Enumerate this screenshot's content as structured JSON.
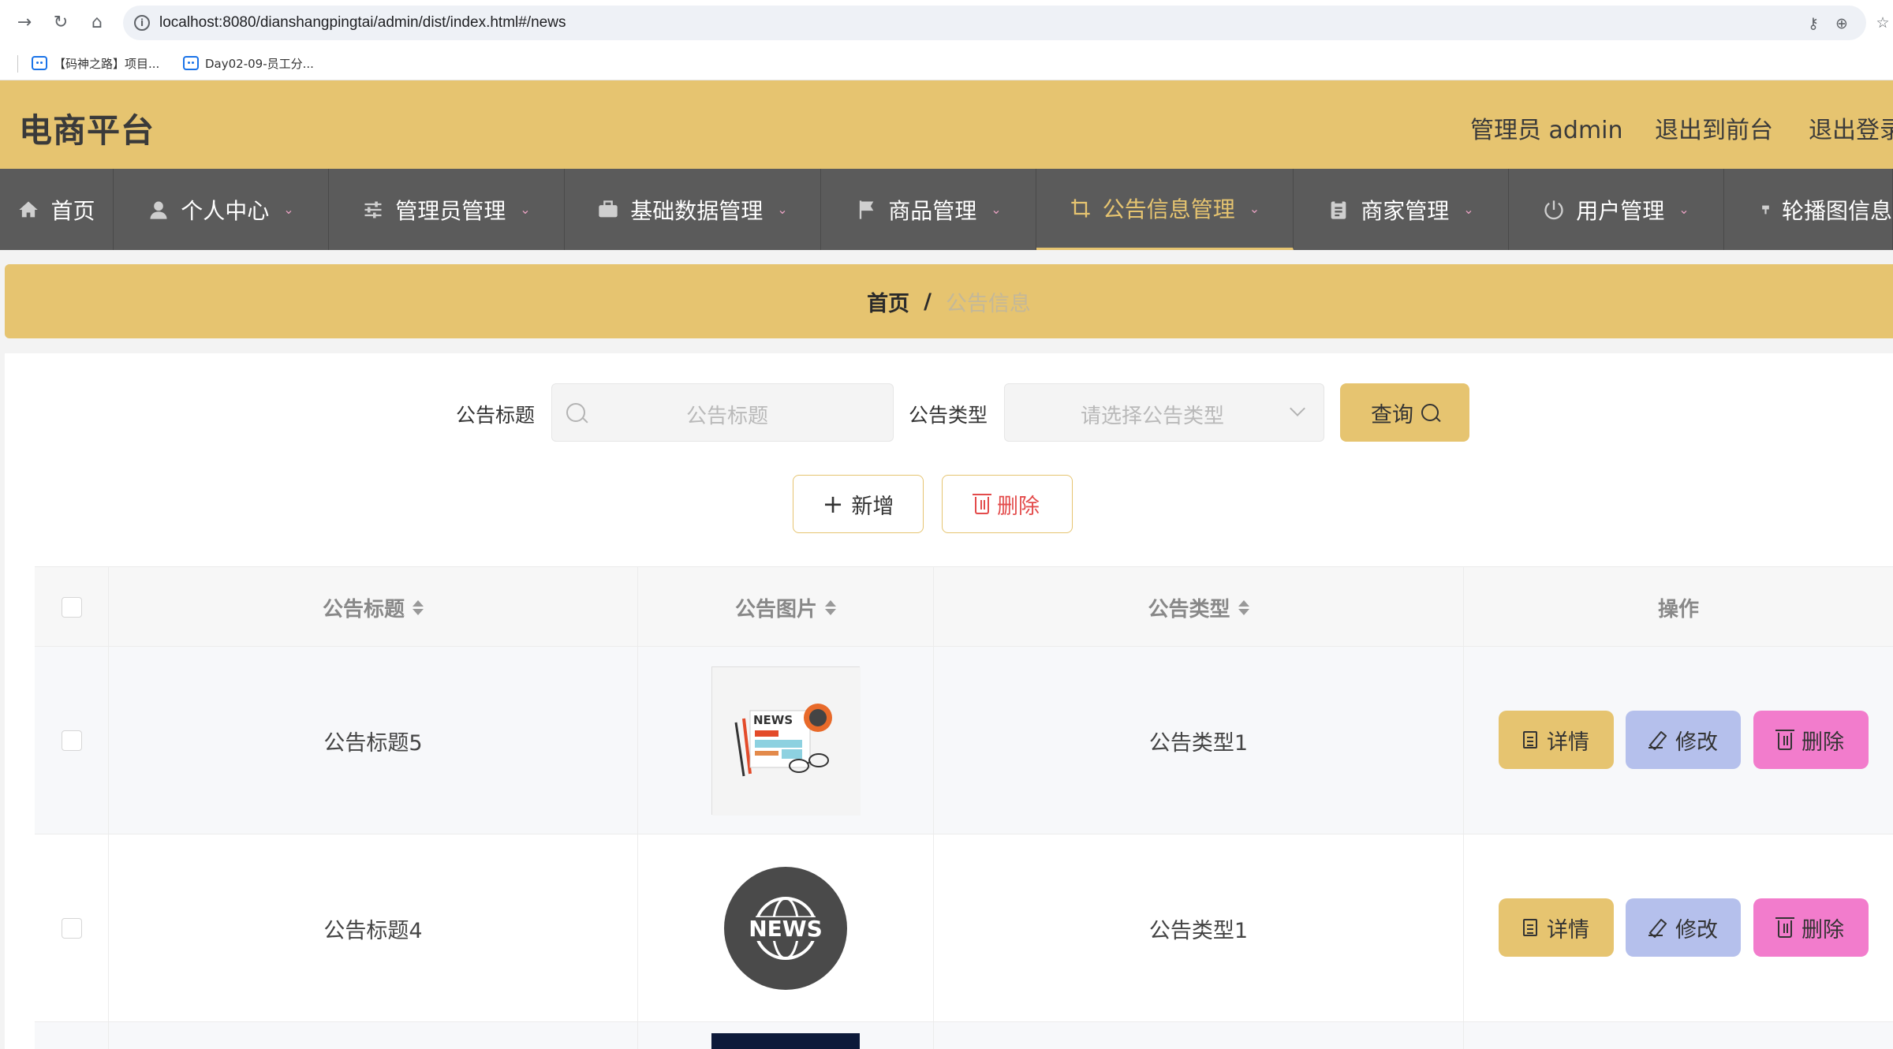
{
  "browser": {
    "url": "localhost:8080/dianshangpingtai/admin/dist/index.html#/news",
    "bookmarks": [
      "【码神之路】项目...",
      "Day02-09-员工分..."
    ]
  },
  "header": {
    "title": "电商平台",
    "user_label": "管理员 admin",
    "to_front_label": "退出到前台",
    "logout_label": "退出登录"
  },
  "nav": {
    "items": [
      {
        "label": "首页",
        "icon": "home-icon"
      },
      {
        "label": "个人中心",
        "icon": "user-icon"
      },
      {
        "label": "管理员管理",
        "icon": "sliders-icon"
      },
      {
        "label": "基础数据管理",
        "icon": "briefcase-icon"
      },
      {
        "label": "商品管理",
        "icon": "flag-icon"
      },
      {
        "label": "公告信息管理",
        "icon": "crop-icon"
      },
      {
        "label": "商家管理",
        "icon": "clipboard-icon"
      },
      {
        "label": "用户管理",
        "icon": "power-icon"
      },
      {
        "label": "轮播图信息",
        "icon": "brush-icon"
      }
    ],
    "active_index": 5
  },
  "breadcrumb": {
    "home": "首页",
    "separator": "/",
    "current": "公告信息"
  },
  "search": {
    "title_label": "公告标题",
    "title_placeholder": "公告标题",
    "type_label": "公告类型",
    "type_placeholder": "请选择公告类型",
    "query_label": "查询"
  },
  "actions": {
    "add_label": "新增",
    "delete_label": "删除"
  },
  "table": {
    "columns": [
      "公告标题",
      "公告图片",
      "公告类型",
      "操作"
    ],
    "rows": [
      {
        "title": "公告标题5",
        "image": "news-illustration",
        "type": "公告类型1"
      },
      {
        "title": "公告标题4",
        "image": "news-globe-badge",
        "type": "公告类型1"
      }
    ],
    "row_buttons": {
      "detail": "详情",
      "edit": "修改",
      "delete": "删除"
    }
  },
  "colors": {
    "accent": "#e6c470",
    "nav_bg": "#5b5b5b",
    "edit_btn": "#b5c0ec",
    "delete_btn": "#f27ccc",
    "danger_text": "#e34b4b"
  }
}
